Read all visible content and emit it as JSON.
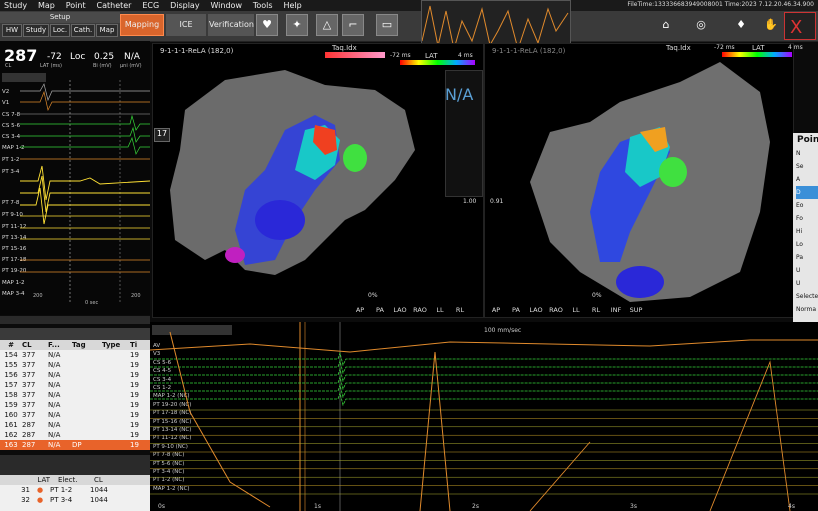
{
  "menu": [
    "Study",
    "Map",
    "Point",
    "Catheter",
    "ECG",
    "Display",
    "Window",
    "Tools",
    "Help"
  ],
  "filetime": "FileTime:133336683949008001 Time:2023 7.12.20.46.34.900",
  "setup": "Setup",
  "setup_tabs": [
    "HW",
    "Study",
    "Loc.",
    "Cath.",
    "Map"
  ],
  "modes": {
    "mapping": "Mapping",
    "ice": "ICE",
    "verification": "Verification"
  },
  "left": {
    "cl": "287",
    "cl_label": "CL",
    "lat": "-72",
    "lat_label": "LAT (ms)",
    "loc": "Loc",
    "bi": "0.25",
    "bi_label": "Bi (mV)",
    "na": "N/A",
    "uni_label": "μni (mV)"
  },
  "channels": [
    "V2",
    "V1",
    "CS 7-8",
    "CS 5-6",
    "CS 3-4",
    "MAP 1-2",
    "PT 1-2",
    "PT 3-4",
    "PT 7-8",
    "PT 9-10",
    "PT 11-12",
    "PT 13-14",
    "PT 15-16",
    "PT 17-18",
    "PT 19-20",
    "MAP 1-2",
    "MAP 3-4"
  ],
  "left_ticks": [
    "200",
    "0 sec",
    "200"
  ],
  "map1": {
    "title": "9-1-1-1-ReLA (182,0)",
    "legend": "Taq.Idx",
    "lat": "LAT",
    "ms_left": "-72 ms",
    "ms_right": "4 ms",
    "na": "N/A",
    "num": "17",
    "scale": "1.00",
    "pct": "0%"
  },
  "map2": {
    "title": "9-1-1-1-ReLA (182,0)",
    "legend": "Taq.Idx",
    "lat": "LAT",
    "ms_left": "-72 ms",
    "ms_right": "4 ms",
    "scale": "0.91",
    "pct": "0%"
  },
  "views": [
    "AP",
    "PA",
    "LAO",
    "RAO",
    "LL",
    "RL",
    "INF",
    "SUP"
  ],
  "table": {
    "headers": [
      "#",
      "CL",
      "F...",
      "Tag",
      "Type",
      "Ti"
    ],
    "rows": [
      [
        "154",
        "377",
        "N/A",
        "",
        "",
        "19"
      ],
      [
        "155",
        "377",
        "N/A",
        "",
        "",
        "19"
      ],
      [
        "156",
        "377",
        "N/A",
        "",
        "",
        "19"
      ],
      [
        "157",
        "377",
        "N/A",
        "",
        "",
        "19"
      ],
      [
        "158",
        "377",
        "N/A",
        "",
        "",
        "19"
      ],
      [
        "159",
        "377",
        "N/A",
        "",
        "",
        "19"
      ],
      [
        "160",
        "377",
        "N/A",
        "",
        "",
        "19"
      ],
      [
        "161",
        "287",
        "N/A",
        "",
        "",
        "19"
      ],
      [
        "162",
        "287",
        "N/A",
        "",
        "",
        "19"
      ],
      [
        "163",
        "287",
        "N/A",
        "DP",
        "",
        "19"
      ]
    ],
    "selected": 9
  },
  "table2": {
    "headers": [
      "LAT",
      "Elect.",
      "CL",
      "F"
    ],
    "rows": [
      [
        "31",
        "PT 1-2",
        "1044"
      ],
      [
        "32",
        "PT 3-4",
        "1044"
      ]
    ]
  },
  "wave": {
    "speed": "100 mm/sec",
    "labels": [
      "AV",
      "V3",
      "CS 5-6",
      "CS 4-5",
      "CS 3-4",
      "CS 1-2",
      "MAP 1-2 (NC)",
      "PT 19-20 (NC)",
      "PT 17-18 (NC)",
      "PT 15-16 (NC)",
      "PT 13-14 (NC)",
      "PT 11-12 (NC)",
      "PT 9-10 (NC)",
      "PT 7-8 (NC)",
      "PT 5-6 (NC)",
      "PT 3-4 (NC)",
      "PT 1-2 (NC)",
      "MAP 1-2 (NC)"
    ],
    "ticks": [
      "0s",
      "1s",
      "2s",
      "3s",
      "4s"
    ]
  },
  "points": {
    "title": "Poin",
    "items": [
      "N",
      "Se",
      "A",
      "D",
      "Eo",
      "Fo",
      "Hi",
      "Lo",
      "Pa",
      "U",
      "U"
    ],
    "selected_label": "Selecte",
    "normal": "Norma",
    "no": "No"
  },
  "colors": {
    "accent": "#d9652c",
    "wave_green": "#37d63a",
    "wave_orange": "#e08a2c"
  }
}
